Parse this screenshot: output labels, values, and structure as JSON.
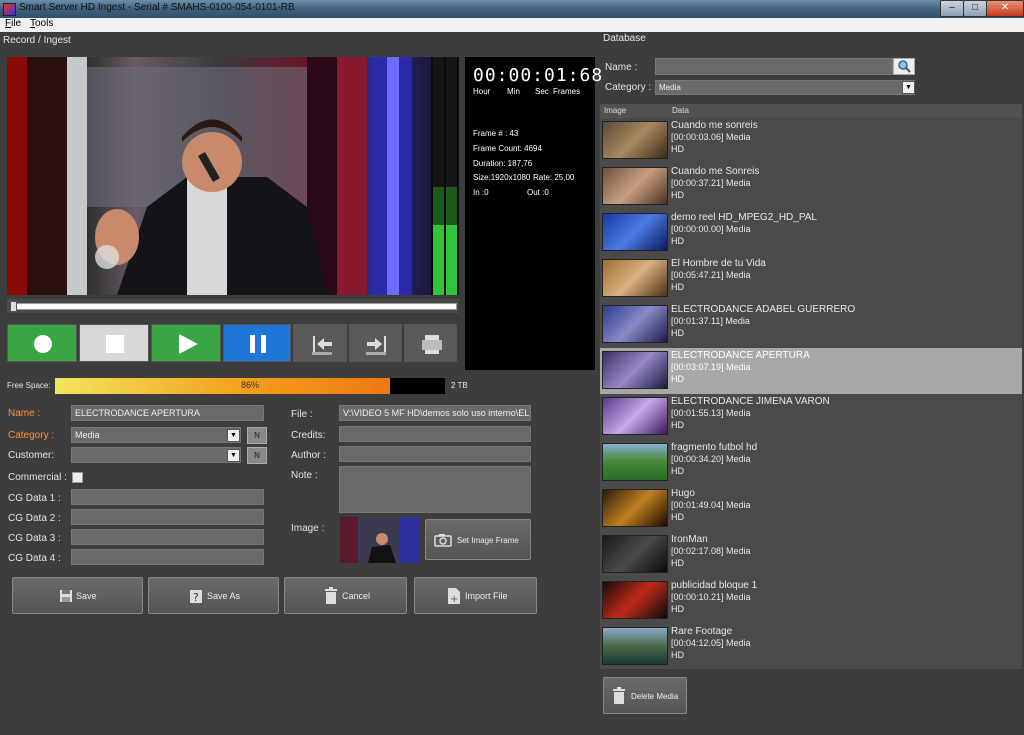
{
  "window": {
    "title": "Smart Server HD Ingest - Serial # SMAHS-0100-054-0101-RB"
  },
  "menu": {
    "file": "File",
    "tools": "Tools"
  },
  "record": {
    "section_title": "Record / Ingest",
    "timecode": "00:00:01:68",
    "timecode_labels": [
      "Hour",
      "Min",
      "Sec",
      "Frames"
    ],
    "frame_number": "Frame # : 43",
    "frame_count": "Frame Count: 4694",
    "duration": "Duration: 187,76",
    "size": "Size:1920x1080",
    "rate": "Rate: 25,00",
    "in": "In :0",
    "out": "Out :0",
    "seek_position": 0.0
  },
  "free_space": {
    "label": "Free Space:",
    "percent": 86,
    "percent_label": "86%",
    "total": "2 TB"
  },
  "form": {
    "name_label": "Name :",
    "name_value": "ELECTRODANCE APERTURA",
    "category_label": "Category :",
    "category_value": "Media",
    "customer_label": "Customer:",
    "customer_value": "",
    "commercial_label": "Commercial :",
    "cg1_label": "CG Data 1 :",
    "cg2_label": "CG Data 2 :",
    "cg3_label": "CG Data 3 :",
    "cg4_label": "CG Data 4 :",
    "file_label": "File :",
    "file_value": "V:\\VIDEO 5 MF HD\\demos solo uso interno\\EL",
    "credits_label": "Credits:",
    "author_label": "Author :",
    "note_label": "Note :",
    "image_label": "Image :",
    "n_button": "N",
    "set_image_frame": "Set Image Frame",
    "accent_label_color": "#ff9030"
  },
  "actions": {
    "save": "Save",
    "save_as": "Save As",
    "cancel": "Cancel",
    "import_file": "Import File"
  },
  "database": {
    "section_title": "Database",
    "name_label": "Name :",
    "category_label": "Category :",
    "category_value": "Media",
    "col_image": "Image",
    "col_data": "Data",
    "delete_button": "Delete Media",
    "items": [
      {
        "title": "Cuando me sonreis",
        "meta": "[00:00:03.06] Media",
        "fmt": "HD"
      },
      {
        "title": "Cuando me Sonreis",
        "meta": "[00:00:37.21] Media",
        "fmt": "HD"
      },
      {
        "title": "demo reel HD_MPEG2_HD_PAL",
        "meta": "[00:00:00.00] Media",
        "fmt": "HD"
      },
      {
        "title": "El Hombre de tu Vida",
        "meta": "[00:05:47.21] Media",
        "fmt": "HD"
      },
      {
        "title": "ELECTRODANCE ADABEL GUERRERO",
        "meta": "[00:01:37.11] Media",
        "fmt": "HD"
      },
      {
        "title": "ELECTRODANCE APERTURA",
        "meta": "[00:03:07.19] Media",
        "fmt": "HD"
      },
      {
        "title": "ELECTRODANCE JIMENA VARON",
        "meta": "[00:01:55.13] Media",
        "fmt": "HD"
      },
      {
        "title": "fragmento futbol hd",
        "meta": "[00:00:34.20] Media",
        "fmt": "HD"
      },
      {
        "title": "Hugo",
        "meta": "[00:01:49.04] Media",
        "fmt": "HD"
      },
      {
        "title": "IronMan",
        "meta": "[00:02:17.08] Media",
        "fmt": "HD"
      },
      {
        "title": "publicidad bloque 1",
        "meta": "[00:00:10.21] Media",
        "fmt": "HD"
      },
      {
        "title": "Rare Footage",
        "meta": "[00:04:12.05] Media",
        "fmt": "HD"
      }
    ],
    "selected_index": 5
  }
}
